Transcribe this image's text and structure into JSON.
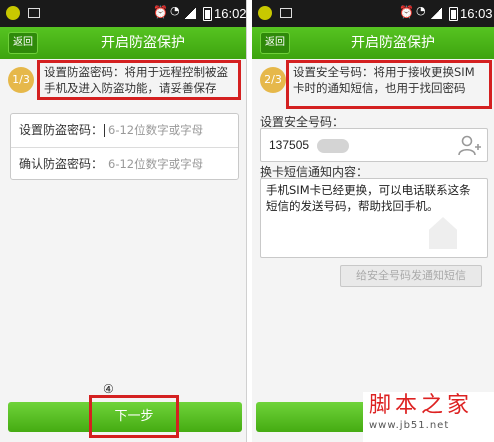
{
  "left_screen": {
    "status_time": "16:02",
    "back_label": "返回",
    "title": "开启防盗保护",
    "step": "1/3",
    "intro": "设置防盗密码：将用于远程控制被盗手机及进入防盗功能，请妥善保存",
    "password_label": "设置防盗密码：",
    "password_placeholder": "6-12位数字或字母",
    "confirm_label": "确认防盗密码：",
    "confirm_placeholder": "6-12位数字或字母",
    "marker": "④",
    "next_label": "下一步"
  },
  "right_screen": {
    "status_time": "16:03",
    "back_label": "返回",
    "title": "开启防盗保护",
    "step": "2/3",
    "intro": "设置安全号码：将用于接收更换SIM卡时的通知短信，也用于找回密码",
    "phone_label": "设置安全号码：",
    "phone_value": "137505",
    "message_label": "换卡短信通知内容：",
    "message_value": "手机SIM卡已经更换，可以电话联系这条短信的发送号码，帮助找回手机。",
    "send_label": "给安全号码发通知短信"
  },
  "watermark": {
    "name": "脚本之家",
    "url": "www.jb51.net"
  },
  "colors": {
    "accent_green": "#4cb518",
    "highlight_red": "#d42020",
    "step_circle": "#e6b84a"
  },
  "icons": [
    "alarm-icon",
    "wifi-icon",
    "signal-icon",
    "battery-icon",
    "contact-icon"
  ]
}
